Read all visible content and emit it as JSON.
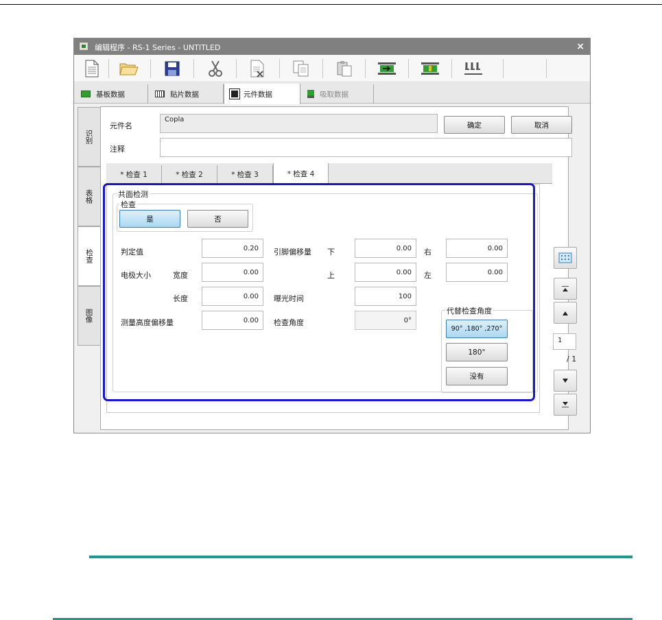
{
  "window": {
    "title": "编辑程序 - RS-1 Series - UNTITLED",
    "close_label": "×"
  },
  "toolbar": {
    "buttons": [
      "new-file-icon",
      "open-folder-icon",
      "save-icon",
      "cut-icon",
      "delete-icon",
      "copy-icon",
      "paste-icon",
      "board-arrow-icon",
      "board-insert-icon",
      "nozzle-icon"
    ]
  },
  "top_tabs": [
    {
      "label": "基板数据",
      "icon": "board-icon",
      "state": "normal"
    },
    {
      "label": "贴片数据",
      "icon": "placement-icon",
      "state": "normal"
    },
    {
      "label": "元件数据",
      "icon": "component-icon",
      "state": "active"
    },
    {
      "label": "吸取数据",
      "icon": "pickup-icon",
      "state": "disabled"
    }
  ],
  "side_tabs": [
    {
      "label": "识别",
      "state": "normal"
    },
    {
      "label": "表格",
      "state": "normal"
    },
    {
      "label": "检查",
      "state": "active"
    },
    {
      "label": "图像",
      "state": "normal"
    }
  ],
  "component": {
    "name_label": "元件名",
    "name_value": "Copla",
    "comment_label": "注释",
    "comment_value": "",
    "ok_label": "确定",
    "cancel_label": "取消"
  },
  "inner_tabs": [
    {
      "label": "* 检查 1",
      "active": false
    },
    {
      "label": "* 检查 2",
      "active": false
    },
    {
      "label": "* 检查 3",
      "active": false
    },
    {
      "label": "* 检查 4",
      "active": true
    }
  ],
  "coplanarity": {
    "group_label": "共面检测",
    "check_group_label": "检查",
    "yes_label": "是",
    "no_label": "否",
    "judge_label": "判定值",
    "judge_value": "0.20",
    "electrode_label": "电极大小",
    "width_label": "宽度",
    "width_value": "0.00",
    "length_label": "长度",
    "length_value": "0.00",
    "height_offset_label": "测量高度偏移量",
    "height_offset_value": "0.00",
    "lead_offset_label": "引脚偏移量",
    "down_label": "下",
    "down_value": "0.00",
    "up_label": "上",
    "up_value": "0.00",
    "right_label": "右",
    "right_value": "0.00",
    "left_label": "左",
    "left_value": "0.00",
    "exposure_label": "曝光时间",
    "exposure_value": "100",
    "angle_label": "检查角度",
    "angle_value": "0°",
    "alt_angle_label": "代替检查角度",
    "alt_angle_options": [
      "90° ,180° ,270°",
      "180°",
      "没有"
    ]
  },
  "pager": {
    "current": "1",
    "total": "/ 1"
  },
  "colors": {
    "highlight": "#1515d8",
    "selected_button": "#a9d8f2",
    "rule_green": "#1a9a8a"
  }
}
